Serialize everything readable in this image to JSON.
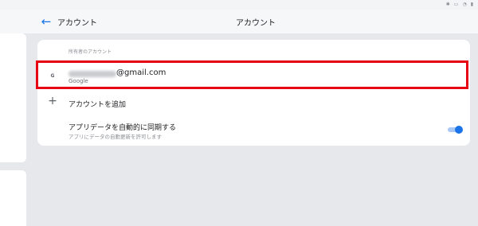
{
  "status_bar": {
    "icons": [
      "bluetooth-icon",
      "vibrate-icon",
      "wifi-icon",
      "battery-icon"
    ]
  },
  "header": {
    "left_title": "アカウント",
    "center_title": "アカウント"
  },
  "accounts": {
    "section_label": "所有者のアカウント",
    "account": {
      "email_domain": "@gmail.com",
      "provider": "Google",
      "icon": "google-icon"
    },
    "add_account_label": "アカウントを追加",
    "sync": {
      "title": "アプリデータを自動的に同期する",
      "subtitle": "アプリにデータの自動更新を許可します",
      "enabled": true
    }
  },
  "colors": {
    "accent": "#1a73e8",
    "highlight": "#e60012"
  }
}
